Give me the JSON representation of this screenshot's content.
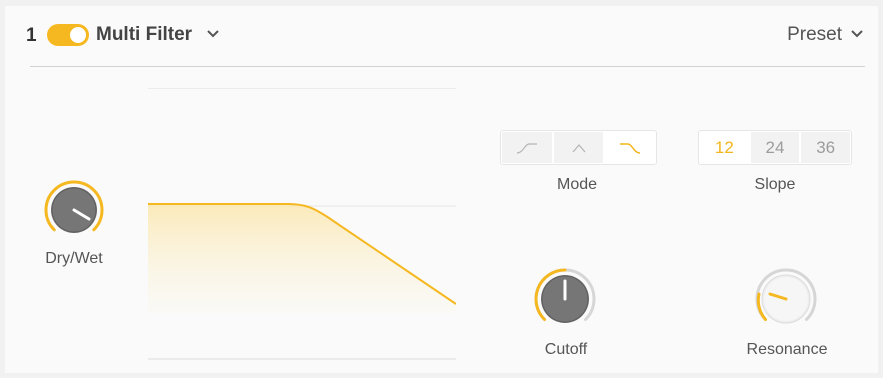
{
  "header": {
    "slot_number": "1",
    "enabled": true,
    "title": "Multi Filter",
    "preset_label": "Preset"
  },
  "knobs": {
    "dry_wet": {
      "label": "Dry/Wet",
      "value": 0.78
    },
    "cutoff": {
      "label": "Cutoff",
      "value": 0.5
    },
    "resonance": {
      "label": "Resonance",
      "value": 0.15
    }
  },
  "mode": {
    "label": "Mode",
    "options": [
      "high-pass",
      "band-pass",
      "low-pass"
    ],
    "selected": "low-pass"
  },
  "slope": {
    "label": "Slope",
    "options": [
      "12",
      "24",
      "36"
    ],
    "selected": "12"
  },
  "colors": {
    "accent": "#f5b820",
    "knob_body": "#6f6f6f",
    "text": "#555555"
  }
}
